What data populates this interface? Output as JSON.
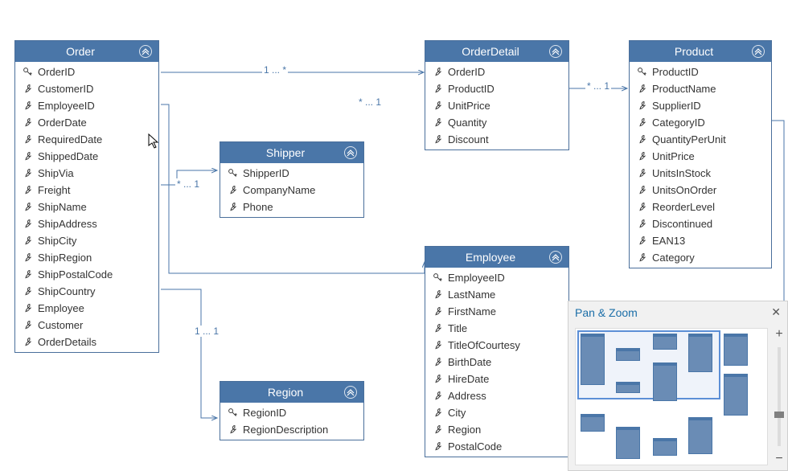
{
  "entities": {
    "order": {
      "title": "Order",
      "fields": [
        {
          "name": "OrderID",
          "key": true
        },
        {
          "name": "CustomerID",
          "key": false
        },
        {
          "name": "EmployeeID",
          "key": false
        },
        {
          "name": "OrderDate",
          "key": false
        },
        {
          "name": "RequiredDate",
          "key": false
        },
        {
          "name": "ShippedDate",
          "key": false
        },
        {
          "name": "ShipVia",
          "key": false
        },
        {
          "name": "Freight",
          "key": false
        },
        {
          "name": "ShipName",
          "key": false
        },
        {
          "name": "ShipAddress",
          "key": false
        },
        {
          "name": "ShipCity",
          "key": false
        },
        {
          "name": "ShipRegion",
          "key": false
        },
        {
          "name": "ShipPostalCode",
          "key": false
        },
        {
          "name": "ShipCountry",
          "key": false
        },
        {
          "name": "Employee",
          "key": false
        },
        {
          "name": "Customer",
          "key": false
        },
        {
          "name": "OrderDetails",
          "key": false
        }
      ]
    },
    "orderdetail": {
      "title": "OrderDetail",
      "fields": [
        {
          "name": "OrderID",
          "key": false
        },
        {
          "name": "ProductID",
          "key": false
        },
        {
          "name": "UnitPrice",
          "key": false
        },
        {
          "name": "Quantity",
          "key": false
        },
        {
          "name": "Discount",
          "key": false
        }
      ]
    },
    "product": {
      "title": "Product",
      "fields": [
        {
          "name": "ProductID",
          "key": true
        },
        {
          "name": "ProductName",
          "key": false
        },
        {
          "name": "SupplierID",
          "key": false
        },
        {
          "name": "CategoryID",
          "key": false
        },
        {
          "name": "QuantityPerUnit",
          "key": false
        },
        {
          "name": "UnitPrice",
          "key": false
        },
        {
          "name": "UnitsInStock",
          "key": false
        },
        {
          "name": "UnitsOnOrder",
          "key": false
        },
        {
          "name": "ReorderLevel",
          "key": false
        },
        {
          "name": "Discontinued",
          "key": false
        },
        {
          "name": "EAN13",
          "key": false
        },
        {
          "name": "Category",
          "key": false
        }
      ]
    },
    "shipper": {
      "title": "Shipper",
      "fields": [
        {
          "name": "ShipperID",
          "key": true
        },
        {
          "name": "CompanyName",
          "key": false
        },
        {
          "name": "Phone",
          "key": false
        }
      ]
    },
    "employee": {
      "title": "Employee",
      "fields": [
        {
          "name": "EmployeeID",
          "key": true
        },
        {
          "name": "LastName",
          "key": false
        },
        {
          "name": "FirstName",
          "key": false
        },
        {
          "name": "Title",
          "key": false
        },
        {
          "name": "TitleOfCourtesy",
          "key": false
        },
        {
          "name": "BirthDate",
          "key": false
        },
        {
          "name": "HireDate",
          "key": false
        },
        {
          "name": "Address",
          "key": false
        },
        {
          "name": "City",
          "key": false
        },
        {
          "name": "Region",
          "key": false
        },
        {
          "name": "PostalCode",
          "key": false
        }
      ]
    },
    "region": {
      "title": "Region",
      "fields": [
        {
          "name": "RegionID",
          "key": true
        },
        {
          "name": "RegionDescription",
          "key": false
        }
      ]
    }
  },
  "relations": {
    "r1": "1 ... *",
    "r2": "* ... 1",
    "r3": "* ... 1",
    "r4": "* ... 1",
    "r5": "1 ... 1"
  },
  "panzoom": {
    "title": "Pan & Zoom"
  }
}
